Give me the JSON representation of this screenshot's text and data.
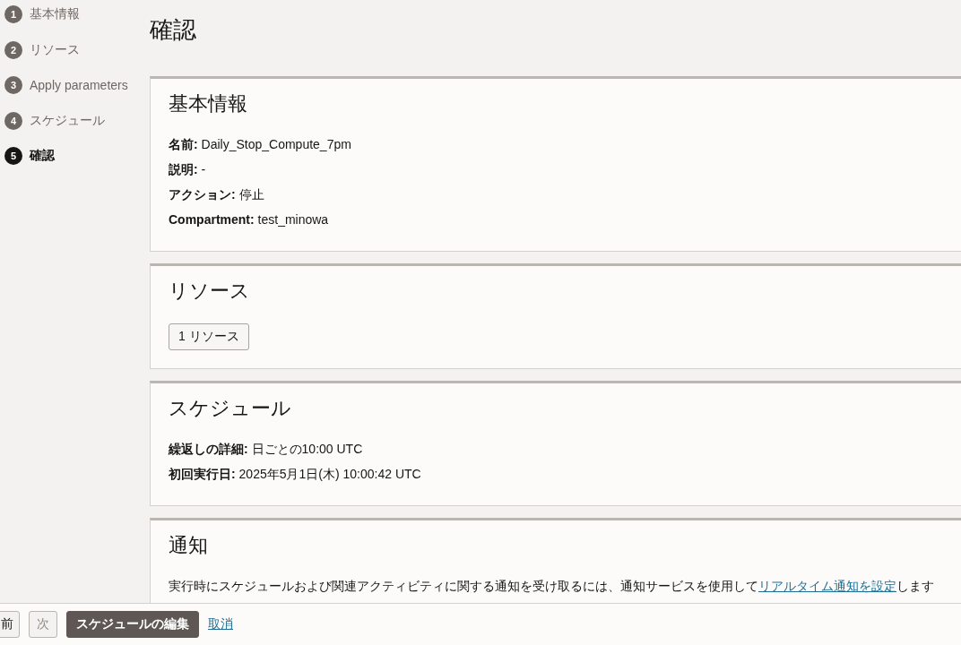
{
  "steps": [
    {
      "number": "1",
      "label": "基本情報",
      "selected": false
    },
    {
      "number": "2",
      "label": "リソース",
      "selected": false
    },
    {
      "number": "3",
      "label": "Apply parameters",
      "selected": false
    },
    {
      "number": "4",
      "label": "スケジュール",
      "selected": false
    },
    {
      "number": "5",
      "label": "確認",
      "selected": true
    }
  ],
  "page_title": "確認",
  "sections": [
    {
      "kind": "fields",
      "title": "基本情報",
      "fields": [
        "**名前:** Daily_Stop_Compute_7pm",
        "**説明:** -",
        "**アクション:** 停止",
        "**Compartment:** test_minowa"
      ]
    },
    {
      "kind": "button",
      "title": "リソース",
      "button": "1 リソース"
    },
    {
      "kind": "fields",
      "title": "スケジュール",
      "fields": [
        "**繰返しの詳細:** 日ごとの10:00 UTC",
        "**初回実行日:** 2025年5月1日(木) 10:00:42 UTC"
      ]
    },
    {
      "kind": "note",
      "title": "通知",
      "text_before": "実行時にスケジュールおよび関連アクティビティに関する通知を受け取るには、通知サービスを使用して",
      "link": "リアルタイム通知を設定",
      "text_after": "します"
    }
  ],
  "footer": {
    "previous": "前",
    "next": "次",
    "edit": "スケジュールの編集",
    "cancel": "取消"
  }
}
